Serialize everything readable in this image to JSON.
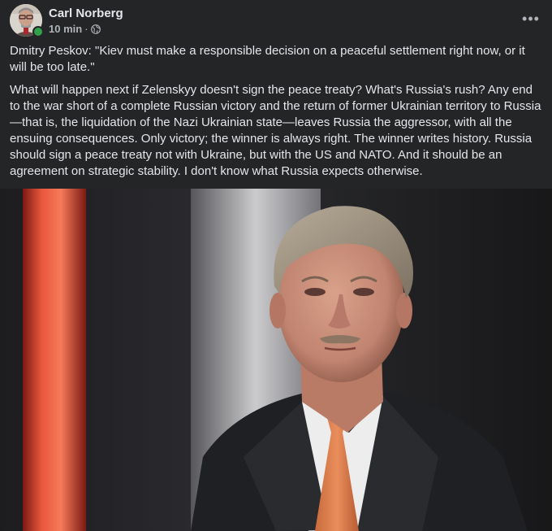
{
  "post": {
    "author": "Carl Norberg",
    "time": "10 min",
    "separator": "·",
    "more_icon": "more-horizontal-icon",
    "more_label": "•••",
    "audience_icon": "globe-icon",
    "quote": "Dmitry Peskov: \"Kiev must make a responsible decision on a peaceful settlement right now, or it will be too late.\"",
    "body": "What will happen next if Zelenskyy doesn't sign the peace treaty? What's Russia's rush? Any end to the war short of a complete Russian victory and the return of former Ukrainian territory to Russia—that is, the liquidation of the Nazi Ukrainian state—leaves Russia the aggressor, with all the ensuing consequences. Only victory; the winner is always right. The winner writes history. Russia should sign a peace treaty not with Ukraine, but with the US and NATO. And it should be an agreement on strategic stability. I don't know what Russia expects otherwise."
  },
  "colors": {
    "background": "#242526",
    "primary_text": "#e4e6eb",
    "secondary_text": "#b0b3b8",
    "online": "#31a24c"
  }
}
